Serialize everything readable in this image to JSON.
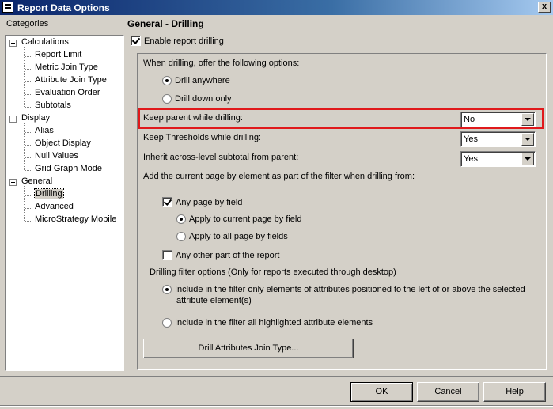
{
  "window": {
    "title": "Report Data Options",
    "close_glyph": "x"
  },
  "sidebar": {
    "label": "Categories",
    "tree": [
      {
        "label": "Calculations",
        "level": 0
      },
      {
        "label": "Report Limit",
        "level": 1
      },
      {
        "label": "Metric Join Type",
        "level": 1
      },
      {
        "label": "Attribute Join Type",
        "level": 1
      },
      {
        "label": "Evaluation Order",
        "level": 1
      },
      {
        "label": "Subtotals",
        "level": 1
      },
      {
        "label": "Display",
        "level": 0
      },
      {
        "label": "Alias",
        "level": 1
      },
      {
        "label": "Object Display",
        "level": 1
      },
      {
        "label": "Null Values",
        "level": 1
      },
      {
        "label": "Grid Graph Mode",
        "level": 1
      },
      {
        "label": "General",
        "level": 0
      },
      {
        "label": "Drilling",
        "level": 1,
        "selected": true
      },
      {
        "label": "Advanced",
        "level": 1
      },
      {
        "label": "MicroStrategy Mobile",
        "level": 1
      }
    ]
  },
  "main": {
    "heading": "General - Drilling",
    "enable_drilling": {
      "label": "Enable report drilling",
      "checked": true
    },
    "offer_options_label": "When drilling, offer the following options:",
    "drill_anywhere": {
      "label": "Drill anywhere",
      "selected": true
    },
    "drill_down_only": {
      "label": "Drill down only",
      "selected": false
    },
    "keep_parent": {
      "label": "Keep parent while drilling:",
      "value": "No"
    },
    "keep_thresholds": {
      "label": "Keep Thresholds while drilling:",
      "value": "Yes"
    },
    "inherit_subtotal": {
      "label": "Inherit across-level subtotal from parent:",
      "value": "Yes"
    },
    "page_by_label": "Add the current page by element as part of the filter when drilling from:",
    "any_page_by_field": {
      "label": "Any page by field",
      "checked": true
    },
    "apply_current": {
      "label": "Apply to current page by field",
      "selected": true
    },
    "apply_all": {
      "label": "Apply to all page by fields",
      "selected": false
    },
    "any_other_part": {
      "label": "Any other part of the report",
      "checked": false
    },
    "filter_options_label": "Drilling filter options (Only for reports executed through desktop)",
    "include_left_above": {
      "label_line1": "Include in the filter only elements of attributes positioned to the left of or above the selected",
      "label_line2": "attribute element(s)",
      "selected": true
    },
    "include_highlighted": {
      "label": "Include in the filter all highlighted attribute elements",
      "selected": false
    },
    "join_type_button": "Drill Attributes Join Type..."
  },
  "footer": {
    "ok": "OK",
    "cancel": "Cancel",
    "help": "Help"
  },
  "colors": {
    "highlight_border": "#e0191b",
    "titlebar_start": "#0a246a",
    "dialog_face": "#d4d0c8"
  }
}
